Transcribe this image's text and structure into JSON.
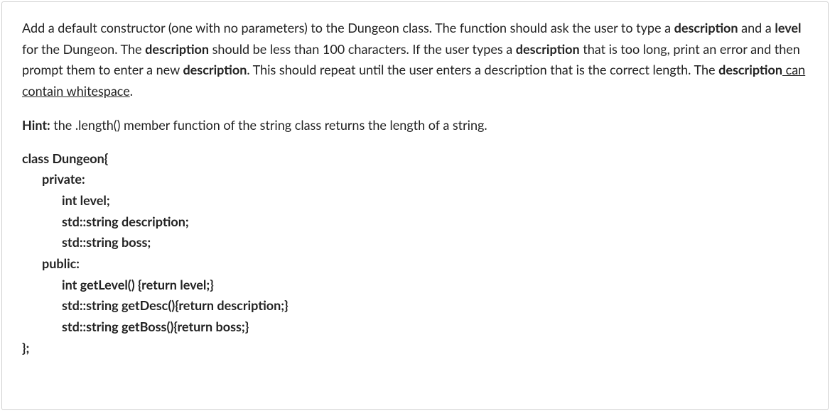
{
  "paragraph1": {
    "part1": "Add a default constructor (one with no parameters) to the Dungeon class. The function should ask the user to type a ",
    "bold1": "description",
    "part2": " and a ",
    "bold2": "level",
    "part3": " for the Dungeon. The ",
    "bold3": "description",
    "part4": " should be less than 100 characters. If the user types a ",
    "bold4": "description",
    "part5": " that is too long, print an error and then prompt them to enter a new ",
    "bold5": "description",
    "part6": ". This should repeat until the user enters a description that is the correct length. The ",
    "bold6": "description",
    "part7_underlined": " can contain whitespace",
    "part8": "."
  },
  "hint": {
    "label": "Hint:",
    "text": " the .length() member function of the string class returns the length of a string."
  },
  "code": {
    "line1": "class Dungeon{",
    "line2": "private:",
    "line3": "int level;",
    "line4": "std::string description;",
    "line5": "std::string boss;",
    "line6": "public:",
    "line7": "int getLevel() {return level;}",
    "line8": "std::string getDesc(){return description;}",
    "line9": "std::string getBoss(){return boss;}",
    "line10": "};"
  }
}
